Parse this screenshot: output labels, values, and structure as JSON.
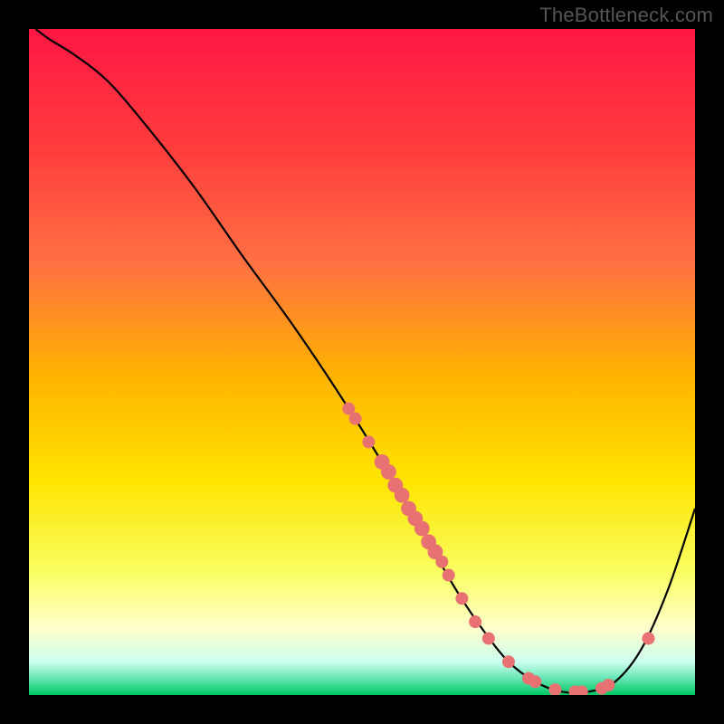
{
  "attribution": "TheBottleneck.com",
  "gradient_stops": [
    {
      "offset": 0.0,
      "color": "#ff1744"
    },
    {
      "offset": 0.18,
      "color": "#ff3d3d"
    },
    {
      "offset": 0.35,
      "color": "#ff7043"
    },
    {
      "offset": 0.52,
      "color": "#ffb300"
    },
    {
      "offset": 0.68,
      "color": "#ffe500"
    },
    {
      "offset": 0.82,
      "color": "#f9ff66"
    },
    {
      "offset": 0.9,
      "color": "#ffffcc"
    },
    {
      "offset": 0.95,
      "color": "#ccffee"
    },
    {
      "offset": 0.975,
      "color": "#66e6b3"
    },
    {
      "offset": 1.0,
      "color": "#00c864"
    }
  ],
  "marker_color": "#e87272",
  "curve_color": "#000000",
  "chart_data": {
    "type": "line",
    "title": "",
    "xlabel": "",
    "ylabel": "",
    "xlim": [
      0,
      100
    ],
    "ylim": [
      0,
      100
    ],
    "grid": false,
    "legend": false,
    "series": [
      {
        "name": "bottleneck-curve",
        "x": [
          1,
          3,
          7,
          12,
          18,
          25,
          32,
          40,
          48,
          56,
          60,
          64,
          68,
          72,
          76,
          80,
          84,
          88,
          92,
          96,
          100
        ],
        "y": [
          100,
          98.5,
          96,
          92,
          85,
          76,
          66,
          55,
          43,
          30,
          23,
          16,
          10,
          5,
          2,
          0.5,
          0.5,
          2,
          7,
          16,
          28
        ]
      }
    ],
    "markers": {
      "name": "highlighted-points",
      "color": "#e87272",
      "points": [
        {
          "x": 48,
          "y": 43,
          "r": 1.0
        },
        {
          "x": 49,
          "y": 41.5,
          "r": 1.0
        },
        {
          "x": 51,
          "y": 38,
          "r": 1.0
        },
        {
          "x": 53,
          "y": 35,
          "r": 1.2
        },
        {
          "x": 54,
          "y": 33.5,
          "r": 1.2
        },
        {
          "x": 55,
          "y": 31.5,
          "r": 1.2
        },
        {
          "x": 56,
          "y": 30,
          "r": 1.2
        },
        {
          "x": 57,
          "y": 28,
          "r": 1.2
        },
        {
          "x": 58,
          "y": 26.5,
          "r": 1.2
        },
        {
          "x": 59,
          "y": 25,
          "r": 1.2
        },
        {
          "x": 60,
          "y": 23,
          "r": 1.2
        },
        {
          "x": 61,
          "y": 21.5,
          "r": 1.2
        },
        {
          "x": 62,
          "y": 20,
          "r": 1.0
        },
        {
          "x": 63,
          "y": 18,
          "r": 1.0
        },
        {
          "x": 65,
          "y": 14.5,
          "r": 1.0
        },
        {
          "x": 67,
          "y": 11,
          "r": 1.0
        },
        {
          "x": 69,
          "y": 8.5,
          "r": 1.0
        },
        {
          "x": 72,
          "y": 5,
          "r": 1.0
        },
        {
          "x": 75,
          "y": 2.5,
          "r": 1.0
        },
        {
          "x": 76,
          "y": 2,
          "r": 1.0
        },
        {
          "x": 79,
          "y": 0.8,
          "r": 1.0
        },
        {
          "x": 82,
          "y": 0.5,
          "r": 1.0
        },
        {
          "x": 83,
          "y": 0.5,
          "r": 1.0
        },
        {
          "x": 86,
          "y": 1,
          "r": 1.0
        },
        {
          "x": 87,
          "y": 1.5,
          "r": 1.0
        },
        {
          "x": 93,
          "y": 8.5,
          "r": 1.0
        }
      ]
    }
  }
}
